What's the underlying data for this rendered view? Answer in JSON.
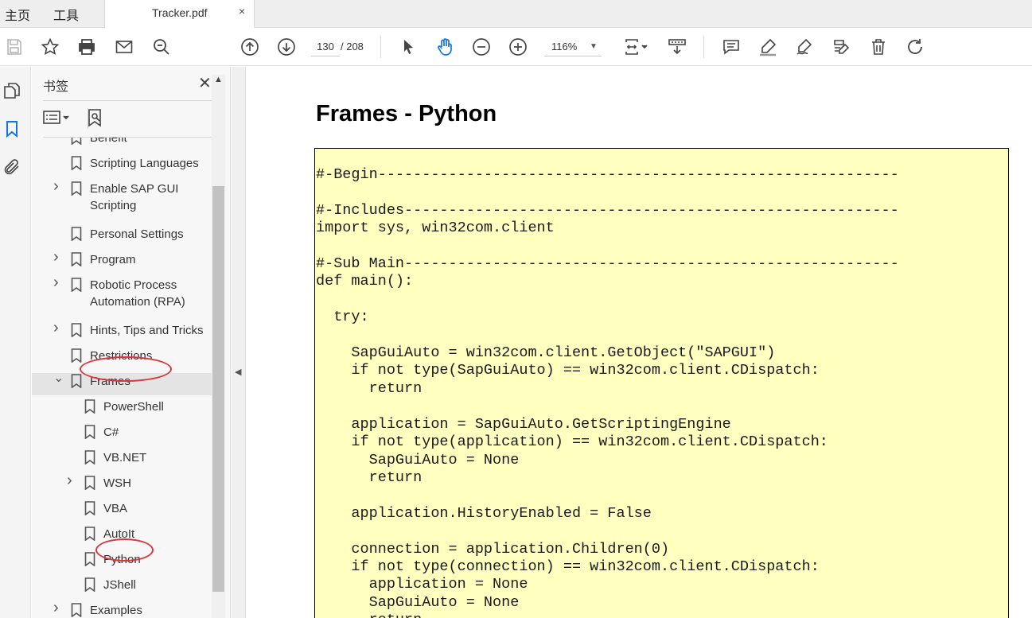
{
  "tabbar": {
    "home": "主页",
    "tools": "工具",
    "doc_tab": {
      "title": "Tracker.pdf",
      "close": "×"
    }
  },
  "toolbar": {
    "page_current": "130",
    "page_total": "/ 208",
    "zoom": "116%",
    "icons": [
      "save-icon",
      "star-icon",
      "print-icon",
      "email-icon",
      "search-zoom-icon",
      "arrow-up-icon",
      "arrow-down-icon",
      "select-cursor-icon",
      "hand-icon",
      "zoom-out-icon",
      "zoom-in-icon",
      "fit-page-icon",
      "scroll-mode-icon",
      "comment-icon",
      "highlight-icon",
      "sign-icon",
      "edit-icon",
      "delete-icon",
      "rotate-icon"
    ]
  },
  "rail": {
    "icons": [
      "pages-icon",
      "bookmark-icon",
      "attachment-icon"
    ]
  },
  "bookmarks": {
    "title": "书签",
    "close": "✕",
    "items": [
      {
        "label": "Benefit",
        "expandable": false,
        "level": 0
      },
      {
        "label": "Scripting Languages",
        "expandable": false,
        "level": 0
      },
      {
        "label": "Enable SAP GUI",
        "label2": "Scripting",
        "expandable": true,
        "level": 0
      },
      {
        "label": "Personal Settings",
        "expandable": false,
        "level": 0
      },
      {
        "label": "Program",
        "expandable": true,
        "level": 0
      },
      {
        "label": "Robotic Process",
        "label2": "Automation (RPA)",
        "expandable": true,
        "level": 0
      },
      {
        "label": "Hints, Tips and Tricks",
        "expandable": true,
        "level": 0
      },
      {
        "label": "Restrictions",
        "expandable": false,
        "level": 0
      },
      {
        "label": "Frames",
        "expandable": true,
        "expanded": true,
        "selected": true,
        "level": 0
      },
      {
        "label": "PowerShell",
        "expandable": false,
        "level": 1
      },
      {
        "label": "C#",
        "expandable": false,
        "level": 1
      },
      {
        "label": "VB.NET",
        "expandable": false,
        "level": 1
      },
      {
        "label": "WSH",
        "expandable": true,
        "level": 1
      },
      {
        "label": "VBA",
        "expandable": false,
        "level": 1
      },
      {
        "label": "AutoIt",
        "expandable": false,
        "level": 1
      },
      {
        "label": "Python",
        "expandable": false,
        "level": 1
      },
      {
        "label": "JShell",
        "expandable": false,
        "level": 1
      },
      {
        "label": "Examples",
        "expandable": true,
        "level": 0
      }
    ]
  },
  "document": {
    "heading": "Frames - Python",
    "code": "#-Begin-----------------------------------------------------------\n\n#-Includes--------------------------------------------------------\nimport sys, win32com.client\n\n#-Sub Main--------------------------------------------------------\ndef main():\n\n  try:\n\n    SapGuiAuto = win32com.client.GetObject(\"SAPGUI\")\n    if not type(SapGuiAuto) == win32com.client.CDispatch:\n      return\n\n    application = SapGuiAuto.GetScriptingEngine\n    if not type(application) == win32com.client.CDispatch:\n      SapGuiAuto = None\n      return\n\n    application.HistoryEnabled = False\n\n    connection = application.Children(0)\n    if not type(connection) == win32com.client.CDispatch:\n      application = None\n      SapGuiAuto = None\n      return"
  },
  "colors": {
    "code_background": "#ffffc0",
    "highlight_oval": "#d9363e",
    "active_icon": "#1473e6"
  }
}
